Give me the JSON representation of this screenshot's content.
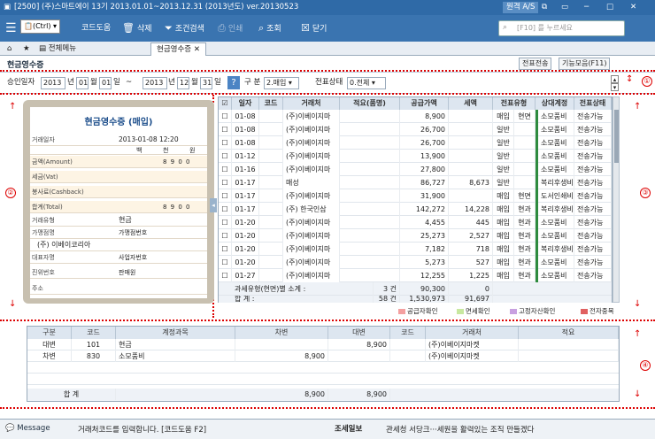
{
  "titlebar": {
    "text": "[2500] (주)스마트에이  13기 2013.01.01~2013.12.31 (2013년도)  ver.20130523",
    "remote": "원격 A/S"
  },
  "toolbar": {
    "ctrl": "(Ctrl)",
    "code_help": "코드도움",
    "delete": "삭제",
    "search_cond": "조건검색",
    "print": "인쇄",
    "view": "조회",
    "close": "닫기",
    "search_placeholder": "[F10] 를 누르세요"
  },
  "tabs": {
    "all_menu": "전체메뉴",
    "active": "현금영수증"
  },
  "page": {
    "title": "현금영수증",
    "send_btn": "전표전송",
    "func_btn": "기능모음(F11)"
  },
  "filter": {
    "date_label": "승인일자",
    "y1": "2013",
    "m1": "01",
    "d1": "01",
    "y2": "2013",
    "m2": "12",
    "d2": "31",
    "yr": "년",
    "mo": "월",
    "dy": "일",
    "tilde": "~",
    "help": "?",
    "kind_label": "구 분",
    "kind_val": "2.매입",
    "status_label": "전표상태",
    "status_val": "0.전체"
  },
  "receipt": {
    "title": "현금영수증 (매입)",
    "date_label": "거래일자",
    "date_val": "2013-01-08 12:20",
    "units": [
      "백",
      "천",
      "원"
    ],
    "rows": [
      {
        "label": "금액(Amount)",
        "val": "8 9 0 0"
      },
      {
        "label": "세금(Vat)",
        "val": ""
      },
      {
        "label": "봉사료(Cashback)",
        "val": ""
      },
      {
        "label": "합계(Total)",
        "val": "8 9 0 0"
      }
    ],
    "type_label": "거래유형",
    "type_val": "현금",
    "store_label": "가맹점명",
    "storeno_label": "가맹점번호",
    "store_val": "(주) 이베이코리아",
    "rep_label": "대표자명",
    "bizno_label": "사업자번호",
    "approve_label": "진위번호",
    "sale_label": "판매원",
    "addr_label": "주소"
  },
  "grid": {
    "headers": [
      "일자",
      "코드",
      "거래처",
      "적요(품명)",
      "공급가액",
      "세액",
      "전표유형",
      "상대계정",
      "전표상태"
    ],
    "rows": [
      [
        "01-08",
        "",
        "(주)이베이지마",
        "",
        "8,900",
        "",
        "매입",
        "현면",
        "소모품비",
        "전송가능"
      ],
      [
        "01-08",
        "",
        "(주)이베이지마",
        "",
        "26,700",
        "",
        "일반",
        "",
        "소모품비",
        "전송가능"
      ],
      [
        "01-08",
        "",
        "(주)이베이지마",
        "",
        "26,700",
        "",
        "일반",
        "",
        "소모품비",
        "전송가능"
      ],
      [
        "01-12",
        "",
        "(주)이베이지마",
        "",
        "13,900",
        "",
        "일반",
        "",
        "소모품비",
        "전송가능"
      ],
      [
        "01-16",
        "",
        "(주)이베이지마",
        "",
        "27,800",
        "",
        "일반",
        "",
        "소모품비",
        "전송가능"
      ],
      [
        "01-17",
        "",
        "매성",
        "",
        "86,727",
        "8,673",
        "일반",
        "",
        "복리후생비",
        "전송가능"
      ],
      [
        "01-17",
        "",
        "(주)이베이지마",
        "",
        "31,900",
        "",
        "매입",
        "현면",
        "도서인쇄비",
        "전송가능"
      ],
      [
        "01-17",
        "",
        "(주) 한국인삼",
        "",
        "142,272",
        "14,228",
        "매입",
        "현과",
        "복리후생비",
        "전송가능"
      ],
      [
        "01-20",
        "",
        "(주)이베이지마",
        "",
        "4,455",
        "445",
        "매입",
        "현과",
        "소모품비",
        "전송가능"
      ],
      [
        "01-20",
        "",
        "(주)이베이지마",
        "",
        "25,273",
        "2,527",
        "매입",
        "현과",
        "소모품비",
        "전송가능"
      ],
      [
        "01-20",
        "",
        "(주)이베이지마",
        "",
        "7,182",
        "718",
        "매입",
        "현과",
        "복리후생비",
        "전송가능"
      ],
      [
        "01-20",
        "",
        "(주)이베이지마",
        "",
        "5,273",
        "527",
        "매입",
        "현과",
        "소모품비",
        "전송가능"
      ],
      [
        "01-27",
        "",
        "(주)이베이지마",
        "",
        "12,255",
        "1,225",
        "매입",
        "현과",
        "소모품비",
        "전송가능"
      ]
    ],
    "subtotal_label": "과세유형(현면)별 소계 :",
    "subtotal_cnt": "3 건",
    "subtotal_supply": "90,300",
    "subtotal_tax": "0",
    "total_label": "합          계 :",
    "total_cnt": "58 건",
    "total_supply": "1,530,973",
    "total_tax": "91,697"
  },
  "legend": [
    "공급자확인",
    "면세확인",
    "고정자산확인",
    "전자중복"
  ],
  "legend_colors": [
    "#f4a0a0",
    "#c8e8a0",
    "#c8a0e0",
    "#e06060"
  ],
  "bottom": {
    "headers": [
      "구분",
      "코드",
      "계정과목",
      "차변",
      "대변",
      "코드",
      "거래처",
      "적요"
    ],
    "rows": [
      [
        "대변",
        "101",
        "현금",
        "",
        "8,900",
        "",
        "(주)이베이지마켓",
        ""
      ],
      [
        "차변",
        "830",
        "소모품비",
        "8,900",
        "",
        "",
        "(주)이베이지마켓",
        ""
      ]
    ],
    "total_label": "합    계",
    "total_debit": "8,900",
    "total_credit": "8,900"
  },
  "status": {
    "message_label": "Message",
    "message": "거래처코드를 입력합니다. [코드도움 F2]",
    "info_label": "조세일보",
    "info_text": "관세청 서당크···세원을 활력있는 조직 만들겠다"
  },
  "markers": [
    "①",
    "②",
    "③",
    "④"
  ]
}
